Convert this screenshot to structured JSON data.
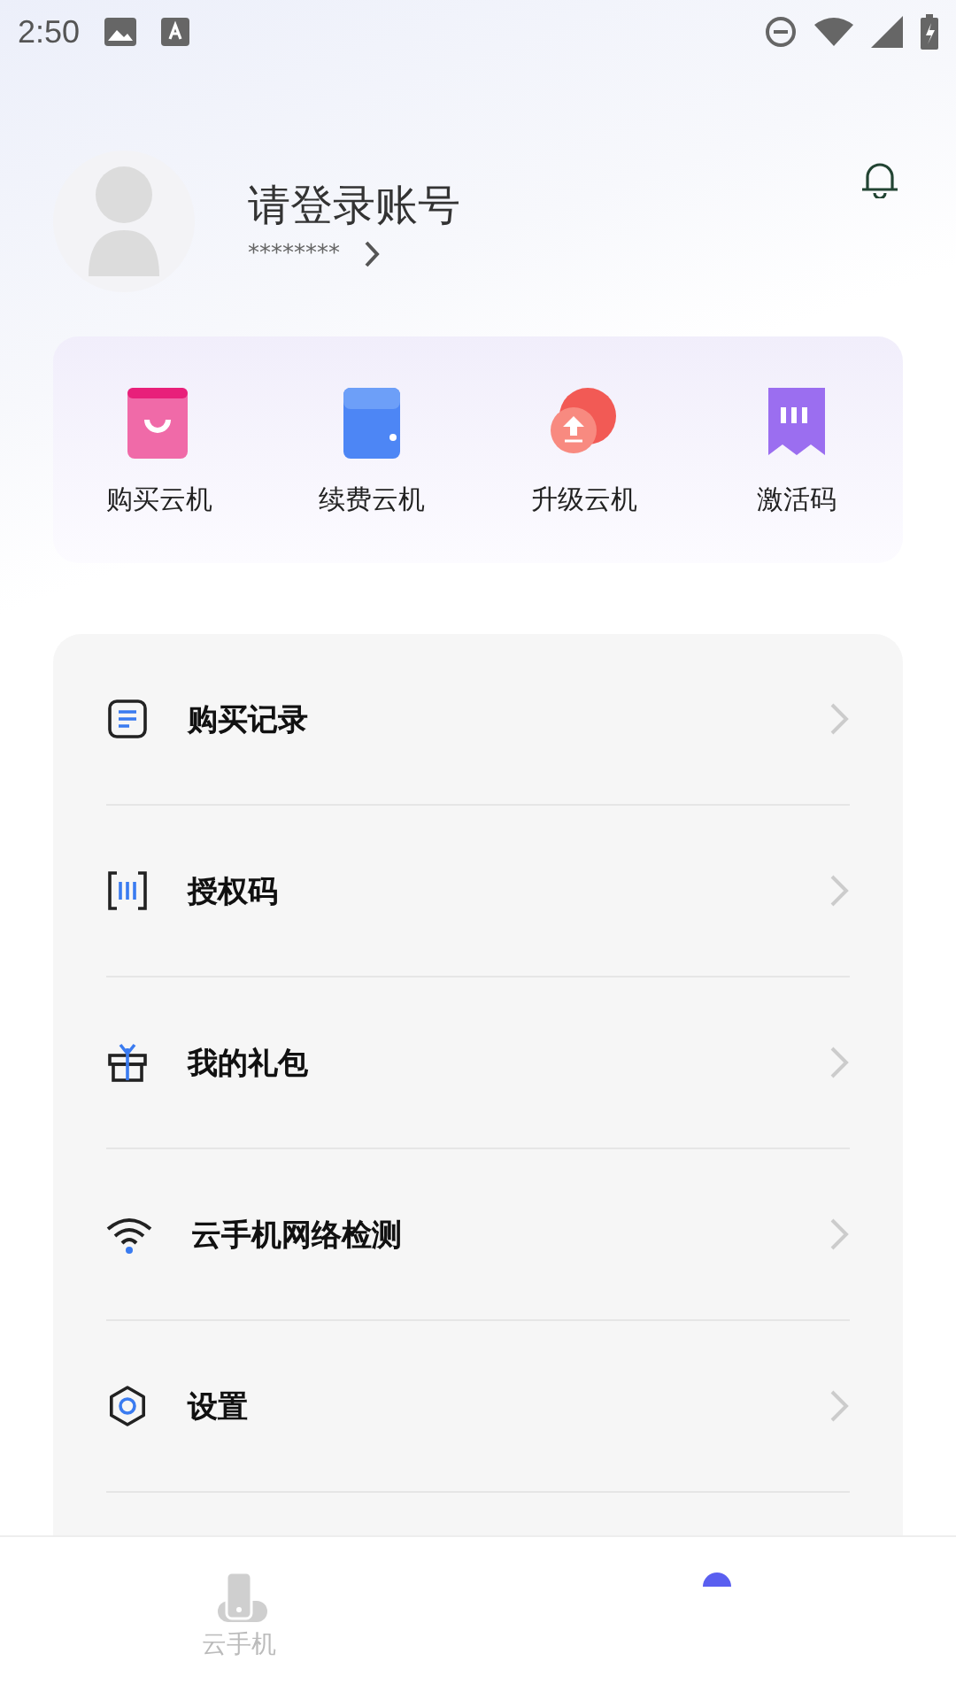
{
  "status_bar": {
    "time": "2:50"
  },
  "profile": {
    "title": "请登录账号",
    "account": "********"
  },
  "shortcuts": [
    {
      "kind": "buy",
      "label": "购买云机"
    },
    {
      "kind": "renew",
      "label": "续费云机"
    },
    {
      "kind": "upgrade",
      "label": "升级云机"
    },
    {
      "kind": "code",
      "label": "激活码"
    }
  ],
  "menu": [
    {
      "kind": "record",
      "label": "购买记录"
    },
    {
      "kind": "auth",
      "label": "授权码"
    },
    {
      "kind": "gift",
      "label": "我的礼包"
    },
    {
      "kind": "wifi",
      "label": "云手机网络检测"
    },
    {
      "kind": "settings",
      "label": "设置"
    }
  ],
  "bottom_nav": [
    {
      "kind": "phone",
      "label": "云手机",
      "selected": false
    },
    {
      "kind": "me",
      "selected": true
    }
  ]
}
